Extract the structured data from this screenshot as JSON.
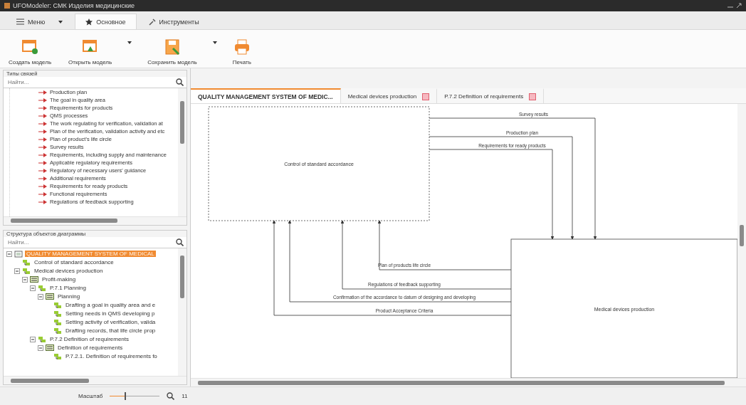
{
  "window": {
    "title": "UFOModeler: СМК Изделия медицинские"
  },
  "ribbon_tabs": [
    {
      "label": "Меню",
      "kind": "menu",
      "selected": false
    },
    {
      "label": "Основное",
      "kind": "star",
      "selected": true
    },
    {
      "label": "Инструменты",
      "kind": "tools",
      "selected": false
    }
  ],
  "toolbar": [
    {
      "label": "Создать модель",
      "kind": "new",
      "dropdown": false
    },
    {
      "label": "Открыть модель",
      "kind": "open",
      "dropdown": true
    },
    {
      "label": "Сохранить модель",
      "kind": "save",
      "dropdown": true
    },
    {
      "label": "Печать",
      "kind": "print",
      "dropdown": false
    }
  ],
  "link_types": {
    "title": "Типы связей",
    "search": {
      "placeholder": "Найти..."
    },
    "items": [
      "Production plan",
      "The goal in quality area",
      "Requirements for products",
      "QMS processes",
      "The work regulating for verification, validation at",
      "Plan of the verification, validation activity and etc",
      "Plan of product's life circle",
      "Survey results",
      "Requirements, including supply and maintenance",
      "Applicable regulatory requirements",
      "Regulatory of necessary users' guidance",
      "Additional requirements",
      "Requirements for ready products",
      "Functional requirements",
      "Regulations of feedback supporting"
    ]
  },
  "structure": {
    "title": "Структура объектов диаграммы",
    "search": {
      "placeholder": "Найти..."
    },
    "tree": [
      {
        "label": "QUALITY MANAGEMENT SYSTEM OF MEDICAL",
        "kind": "root",
        "selected": true,
        "expanded": true,
        "children": [
          {
            "label": "Control of standard accordance",
            "kind": "block",
            "selected": false
          },
          {
            "label": "Medical devices production",
            "kind": "block",
            "selected": false,
            "expanded": true,
            "children": [
              {
                "label": "Profit-making",
                "kind": "diagram",
                "selected": false,
                "expanded": true,
                "children": [
                  {
                    "label": "P.7.1 Planning",
                    "kind": "block",
                    "selected": false,
                    "expanded": true,
                    "children": [
                      {
                        "label": "Planning",
                        "kind": "diagram",
                        "selected": false,
                        "expanded": true,
                        "children": [
                          {
                            "label": "Drafting a goal in quality area and e",
                            "kind": "block",
                            "selected": false
                          },
                          {
                            "label": "Setting needs in QMS developing p",
                            "kind": "block",
                            "selected": false
                          },
                          {
                            "label": "Setting activity of verification, valida",
                            "kind": "block",
                            "selected": false
                          },
                          {
                            "label": "Drafting records, that life circle prop",
                            "kind": "block",
                            "selected": false
                          }
                        ]
                      }
                    ]
                  },
                  {
                    "label": "P.7.2 Definition of requirements",
                    "kind": "block",
                    "selected": false,
                    "expanded": true,
                    "children": [
                      {
                        "label": "Definition of requirements",
                        "kind": "diagram",
                        "selected": false,
                        "expanded": true,
                        "children": [
                          {
                            "label": "P.7.2.1. Definition of requirements fo",
                            "kind": "block",
                            "selected": false
                          }
                        ]
                      }
                    ]
                  }
                ]
              }
            ]
          }
        ]
      }
    ]
  },
  "doc_tabs": [
    {
      "label": "QUALITY MANAGEMENT SYSTEM OF MEDIC...",
      "selected": true,
      "closable": false
    },
    {
      "label": "Medical devices production",
      "selected": false,
      "closable": true
    },
    {
      "label": "P.7.2 Definition of requirements",
      "selected": false,
      "closable": true
    }
  ],
  "diagram": {
    "nodes": [
      {
        "label": "Control of standard accordance",
        "kind": "dashed"
      },
      {
        "label": "Medical devices production",
        "kind": "solid"
      }
    ],
    "arrows": [
      {
        "label": "Survey results",
        "kind": "output"
      },
      {
        "label": "Production plan",
        "kind": "output"
      },
      {
        "label": "Requirements for ready products",
        "kind": "output"
      },
      {
        "label": "Plan of products life circle",
        "kind": "feedback"
      },
      {
        "label": "Regulations of feedback supporting",
        "kind": "feedback"
      },
      {
        "label": "Confirmation of the accordance to datum of designing and developing",
        "kind": "feedback"
      },
      {
        "label": "Product Acceptance Criteria",
        "kind": "feedback"
      }
    ]
  },
  "status_bar": {
    "scale_label": "Масштаб",
    "scale": {
      "level": 0.3
    },
    "zoom": "11"
  }
}
